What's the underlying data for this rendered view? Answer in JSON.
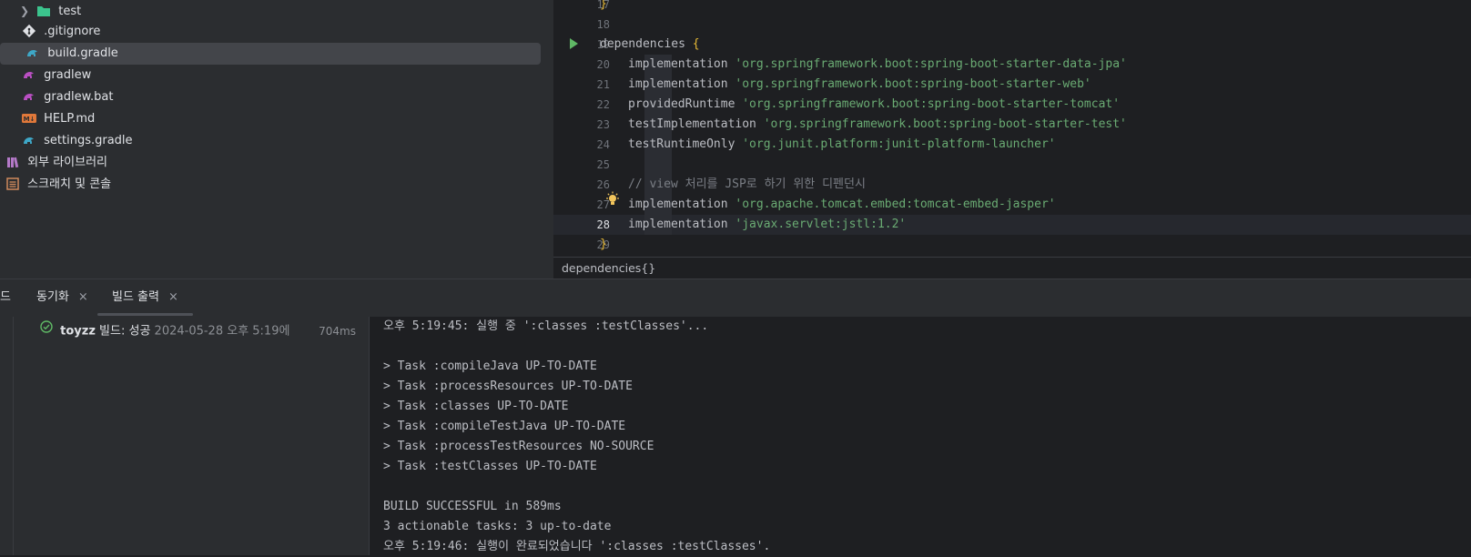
{
  "project_tree": [
    {
      "label": "test",
      "icon": "folder-icon",
      "expandable": true
    },
    {
      "label": ".gitignore",
      "icon": "git-icon"
    },
    {
      "label": "build.gradle",
      "icon": "gradle-icon",
      "selected": true
    },
    {
      "label": "gradlew",
      "icon": "gradle-icon"
    },
    {
      "label": "gradlew.bat",
      "icon": "gradle-icon"
    },
    {
      "label": "HELP.md",
      "icon": "markdown-icon"
    },
    {
      "label": "settings.gradle",
      "icon": "gradle-icon"
    },
    {
      "label": "외부 라이브러리",
      "icon": "library-icon"
    },
    {
      "label": "스크래치 및 콘솔",
      "icon": "scratch-icon"
    }
  ],
  "editor": {
    "line_numbers": [
      "17",
      "18",
      "19",
      "20",
      "21",
      "22",
      "23",
      "24",
      "25",
      "26",
      "27",
      "28",
      "29"
    ],
    "lines": {
      "l17": "}",
      "l19_kw": "dependencies ",
      "l19_brace": "{",
      "l20_a": "implementation ",
      "l20_b": "'org.springframework.boot:spring-boot-starter-data-jpa'",
      "l21_a": "implementation ",
      "l21_b": "'org.springframework.boot:spring-boot-starter-web'",
      "l22_a": "providedRuntime ",
      "l22_b": "'org.springframework.boot:spring-boot-starter-tomcat'",
      "l23_a": "testImplementation ",
      "l23_b": "'org.springframework.boot:spring-boot-starter-test'",
      "l24_a": "testRuntimeOnly ",
      "l24_b": "'org.junit.platform:junit-platform-launcher'",
      "l26": "// view 처리를 JSP로 하기 위한 디펜던시",
      "l27_a": "implementation ",
      "l27_b": "'org.apache.tomcat.embed:tomcat-embed-jasper'",
      "l28_a": "implementation ",
      "l28_b": "'javax.servlet:jstl:1.2'",
      "l29": "}"
    },
    "current_line": "28",
    "breadcrumb": "dependencies{}"
  },
  "tool_tabs": {
    "partial": "드",
    "sync": "동기화",
    "build_output": "빌드 출력",
    "close": "×"
  },
  "build": {
    "name": "toyzz",
    "status": "빌드: 성공",
    "date": "2024-05-28 오후 5:19에",
    "duration": "704ms"
  },
  "console": [
    "오후 5:19:45: 실행 중 ':classes :testClasses'...",
    "",
    "> Task :compileJava UP-TO-DATE",
    "> Task :processResources UP-TO-DATE",
    "> Task :classes UP-TO-DATE",
    "> Task :compileTestJava UP-TO-DATE",
    "> Task :processTestResources NO-SOURCE",
    "> Task :testClasses UP-TO-DATE",
    "",
    "BUILD SUCCESSFUL in 589ms",
    "3 actionable tasks: 3 up-to-date",
    "오후 5:19:46: 실행이 완료되었습니다 ':classes :testClasses'."
  ]
}
